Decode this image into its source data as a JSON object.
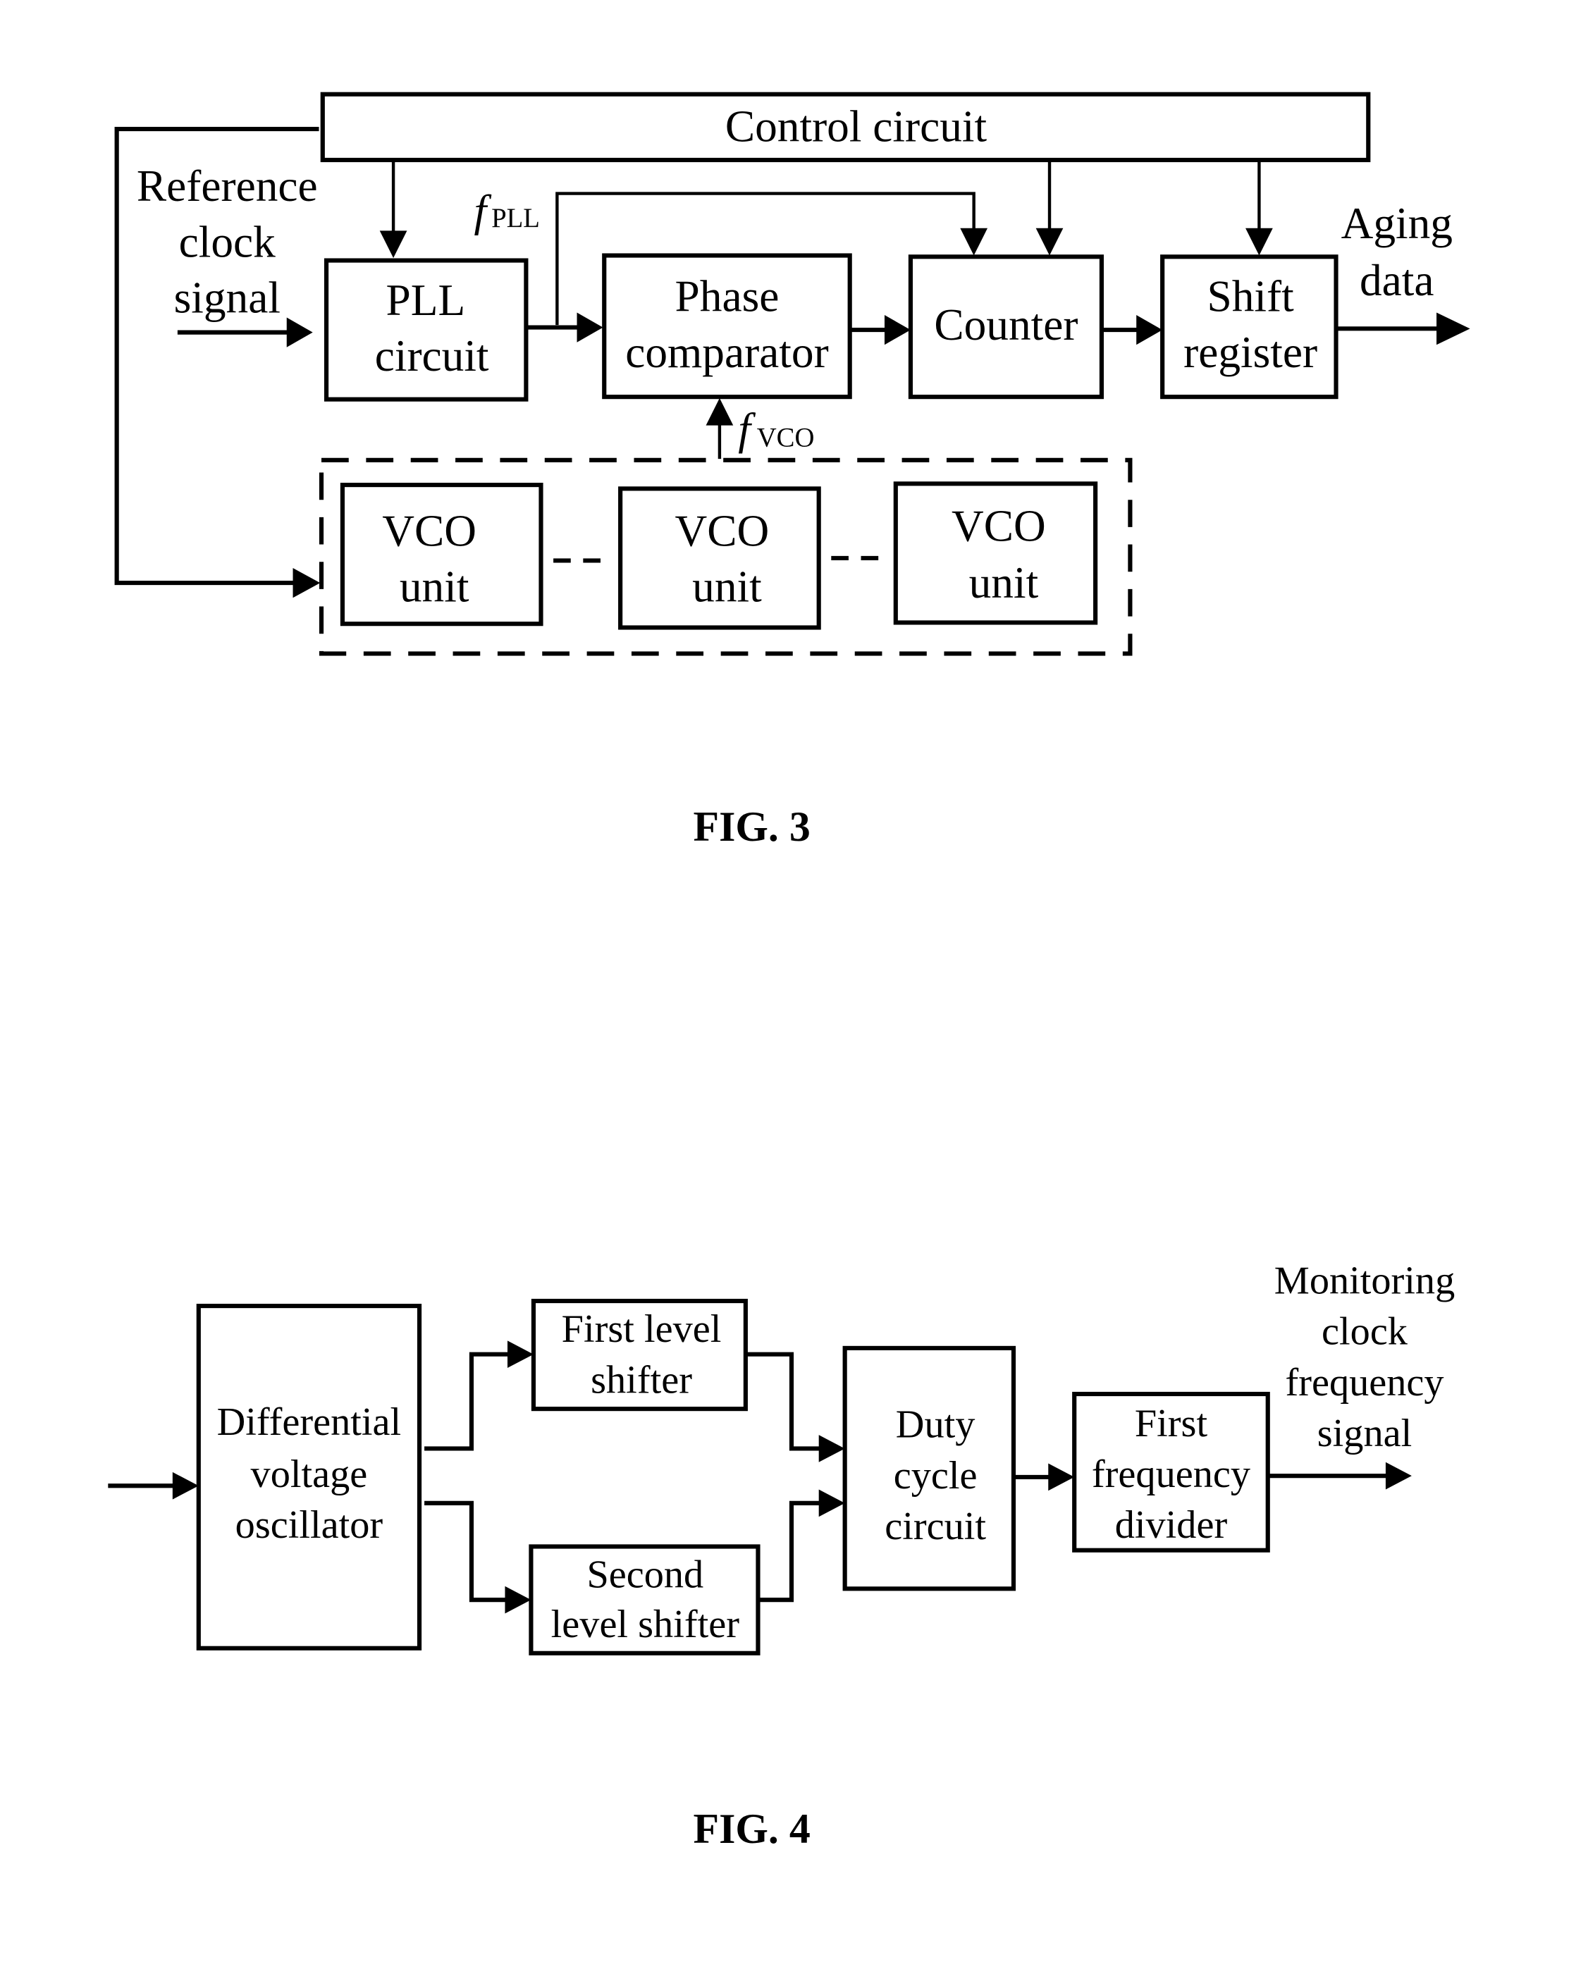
{
  "fig3": {
    "caption": "FIG. 3",
    "control_circuit": "Control circuit",
    "reference_input": [
      "Reference",
      "clock",
      "signal"
    ],
    "pll_circuit": [
      "PLL",
      "circuit"
    ],
    "phase_comparator": [
      "Phase",
      "comparator"
    ],
    "counter": "Counter",
    "shift_register": [
      "Shift",
      "register"
    ],
    "output": [
      "Aging",
      "data"
    ],
    "f_pll": {
      "symbol": "f",
      "subscript": "PLL"
    },
    "f_vco": {
      "symbol": "f",
      "subscript": "VCO"
    },
    "vco_units": [
      [
        "VCO",
        "unit"
      ],
      [
        "VCO",
        "unit"
      ],
      [
        "VCO",
        "unit"
      ]
    ]
  },
  "fig4": {
    "caption": "FIG. 4",
    "oscillator": [
      "Differential",
      "voltage",
      "oscillator"
    ],
    "first_level_shifter": [
      "First level",
      "shifter"
    ],
    "second_level_shifter": [
      "Second",
      "level shifter"
    ],
    "duty_cycle_circuit": [
      "Duty",
      "cycle",
      "circuit"
    ],
    "first_frequency_divider": [
      "First",
      "frequency",
      "divider"
    ],
    "output": [
      "Monitoring",
      "clock",
      "frequency",
      "signal"
    ]
  }
}
